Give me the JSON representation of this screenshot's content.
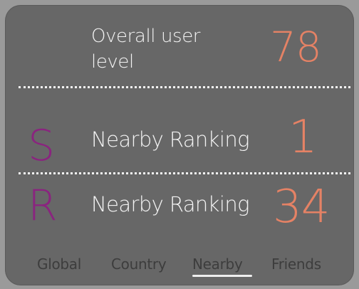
{
  "overall": {
    "label": "Overall user level",
    "value": "78"
  },
  "rankings": [
    {
      "letter": "S",
      "label": "Nearby Ranking",
      "value": "1"
    },
    {
      "letter": "R",
      "label": "Nearby Ranking",
      "value": "34"
    }
  ],
  "tabs": [
    {
      "label": "Global"
    },
    {
      "label": "Country"
    },
    {
      "label": "Nearby",
      "selected": true
    },
    {
      "label": "Friends"
    }
  ],
  "colors": {
    "accent_value": "#e58265",
    "rank_letter": "#8a247f",
    "card_bg": "#676767",
    "page_bg": "#9a9a9a"
  }
}
